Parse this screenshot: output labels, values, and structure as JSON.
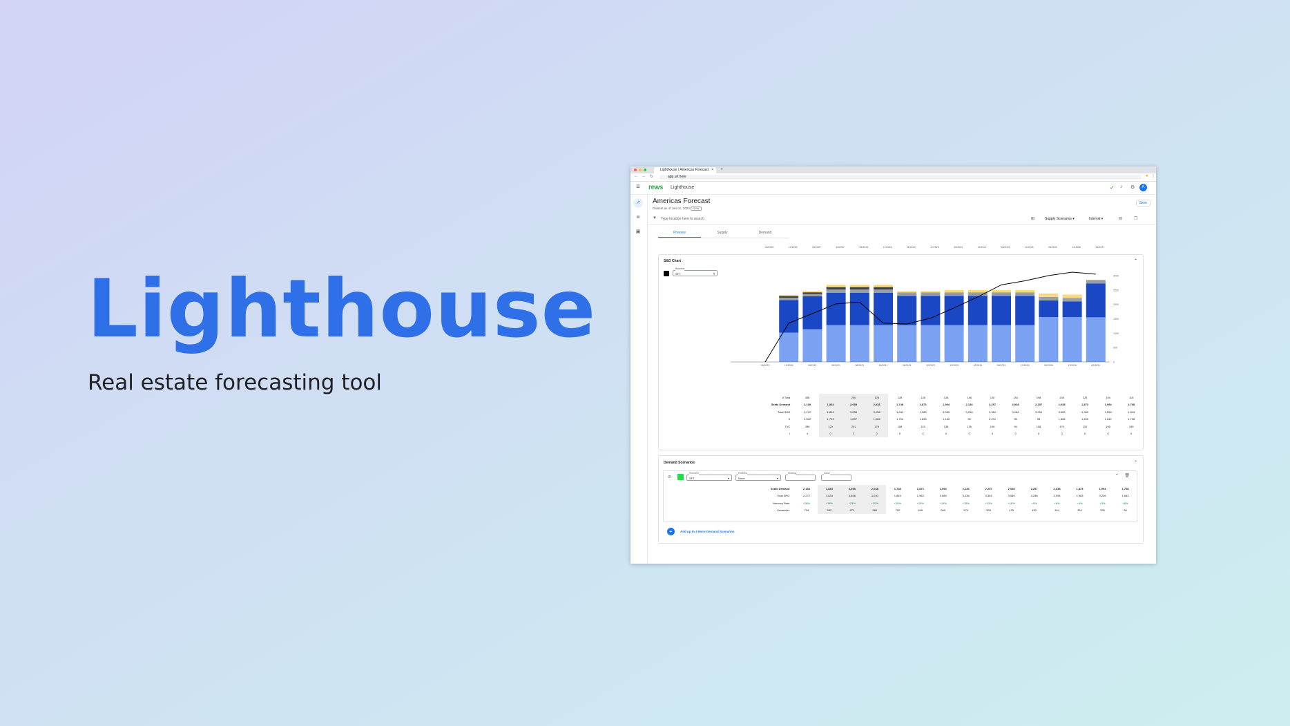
{
  "hero": {
    "title": "Lighthouse",
    "subtitle": "Real estate forecasting tool"
  },
  "browser": {
    "tab_title": "Lighthouse / Americas Forecast",
    "url": "app.url.here"
  },
  "app": {
    "logo": "rews",
    "name": "Lighthouse",
    "avatar": "A"
  },
  "page": {
    "title": "Americas Forecast",
    "dataset_label": "Dataset as of Jan 01, 2023",
    "dataset_badge": "FINAL",
    "save_label": "Save",
    "search_placeholder": "Type location here to search",
    "supply_scenarios": "Supply Scenarios",
    "interval": "Interval"
  },
  "tabs": [
    "Preview",
    "Supply",
    "Demand"
  ],
  "dates": [
    "06/2025",
    "12/2026",
    "06/2027",
    "12/2027",
    "06/2023",
    "12/2023",
    "06/2023",
    "12/2023",
    "06/2024",
    "12/2024",
    "06/2025",
    "12/2025",
    "06/2026",
    "12/2026",
    "06/2027"
  ],
  "sd_chart": {
    "title": "S&D Chart",
    "baseline_label": "Baseline",
    "baseline_value": "SFT",
    "y_ticks": [
      "3000",
      "2500",
      "2000",
      "1500",
      "1000",
      "500",
      "0"
    ],
    "x_labels": [
      "06/2022",
      "12/2026",
      "06/2021",
      "06/2021",
      "06/2021",
      "06/2021",
      "06/2021",
      "12/2023",
      "12/2023",
      "12/2024",
      "06/2025",
      "12/2025",
      "06/2026",
      "12/2026",
      "06/2021"
    ],
    "rows": [
      {
        "label": "# Total",
        "cells": [
          "336",
          "",
          "250",
          "128",
          "128",
          "128",
          "126",
          "146",
          "120",
          "144",
          "198",
          "145",
          "125",
          "194",
          "115"
        ]
      },
      {
        "label": "Seats Demand",
        "bold": true,
        "cells": [
          "2,168",
          "1,834",
          "2,058",
          "2,038",
          "1,748",
          "1,873",
          "1,994",
          "2,136",
          "2,257",
          "2,038",
          "2,257",
          "2,038",
          "1,873",
          "1,994",
          "1,768"
        ]
      },
      {
        "label": "Total SHG",
        "cells": [
          "2,272",
          "1,804",
          "3,058",
          "3,058",
          "1,843",
          "1,983",
          "3,089",
          "3,256",
          "3,361",
          "3,089",
          "3,256",
          "3,089",
          "1,983",
          "3,256",
          "1,843"
        ]
      },
      {
        "label": "II",
        "cells": [
          "2,522",
          "1,793",
          "1,837",
          "1,668",
          "1,754",
          "1,693",
          "1,183",
          "95",
          "2,201",
          "95",
          "95",
          "1,866",
          "1,650",
          "1,042",
          "1,738"
        ]
      },
      {
        "label": "TVC",
        "cells": [
          "398",
          "120",
          "201",
          "178",
          "108",
          "115",
          "138",
          "135",
          "106",
          "94",
          "108",
          "170",
          "151",
          "108",
          "105"
        ]
      },
      {
        "label": "I",
        "cells": [
          "4",
          "0",
          "0",
          "0",
          "0",
          "0",
          "0",
          "0",
          "0",
          "0",
          "0",
          "0",
          "0",
          "0",
          "0"
        ]
      }
    ]
  },
  "chart_data": {
    "type": "bar",
    "title": "S&D Chart",
    "categories": [
      "06/2022",
      "12/2026",
      "06/2021",
      "06/2021",
      "06/2021",
      "06/2021",
      "06/2021",
      "12/2023",
      "12/2023",
      "12/2024",
      "06/2025",
      "12/2025",
      "06/2026",
      "12/2026",
      "06/2021"
    ],
    "ylim": [
      0,
      3000
    ],
    "series": [
      {
        "name": "",
        "color": "#7ba1f2",
        "values": [
          0,
          1020,
          1140,
          1280,
          1280,
          1280,
          1280,
          1280,
          1280,
          1280,
          1280,
          1280,
          1560,
          1560,
          1550
        ]
      },
      {
        "name": "",
        "color": "#1a48c4",
        "values": [
          0,
          1130,
          1140,
          1120,
          1120,
          1120,
          1020,
          1020,
          1020,
          1020,
          1020,
          1020,
          580,
          540,
          1180
        ]
      },
      {
        "name": "",
        "color": "#9aa0a6",
        "values": [
          0,
          80,
          80,
          120,
          120,
          120,
          120,
          120,
          120,
          120,
          120,
          120,
          120,
          120,
          120
        ]
      },
      {
        "name": "",
        "color": "#3c4043",
        "values": [
          0,
          60,
          60,
          80,
          80,
          80,
          0,
          0,
          0,
          0,
          0,
          0,
          0,
          0,
          0
        ]
      },
      {
        "name": "",
        "color": "#f7d87a",
        "values": [
          0,
          40,
          40,
          80,
          80,
          80,
          40,
          40,
          80,
          80,
          80,
          80,
          120,
          120,
          0
        ]
      }
    ],
    "line": [
      0,
      1350,
      1680,
      2020,
      2080,
      1350,
      1320,
      1520,
      1880,
      2260,
      2680,
      2820,
      3000,
      3120,
      3050
    ]
  },
  "demand": {
    "title": "Demand Scenarios",
    "scenario_label": "Scenario",
    "scenario_value": "SFT",
    "portfolio_label": "Portfolio",
    "portfolio_value": "None",
    "sharing_label": "Sharing",
    "value_label": "Value",
    "add_label": "Add up to 3 More Demand Scenarios",
    "rows": [
      {
        "label": "Seats Demand",
        "bold": true,
        "cells": [
          "2,168",
          "1,834",
          "2,058",
          "2,038",
          "1,748",
          "1,873",
          "1,994",
          "2,136",
          "2,257",
          "2,038",
          "2,257",
          "2,038",
          "1,873",
          "1,994",
          "1,768"
        ]
      },
      {
        "label": "Total SHG",
        "cells": [
          "2,272",
          "1,834",
          "3,858",
          "3,030",
          "1,843",
          "1,983",
          "3,089",
          "3,236",
          "3,361",
          "3,089",
          "3,236",
          "3,094",
          "1,983",
          "3,236",
          "1,843"
        ]
      },
      {
        "label": "Vacancy Rate",
        "green": true,
        "cells": [
          "+26%",
          "+18%",
          "+21%",
          "+30%",
          "+20%",
          "+19%",
          "+16%",
          "+15%",
          "+13%",
          "+16%",
          "+9%",
          "+6%",
          "+4%",
          "+3%",
          "+5%"
        ]
      },
      {
        "label": "Vacancies",
        "cells": [
          "734",
          "582",
          "673",
          "980",
          "720",
          "645",
          "600",
          "570",
          "503",
          "475",
          "430",
          "344",
          "310",
          "259",
          "96"
        ]
      }
    ]
  }
}
